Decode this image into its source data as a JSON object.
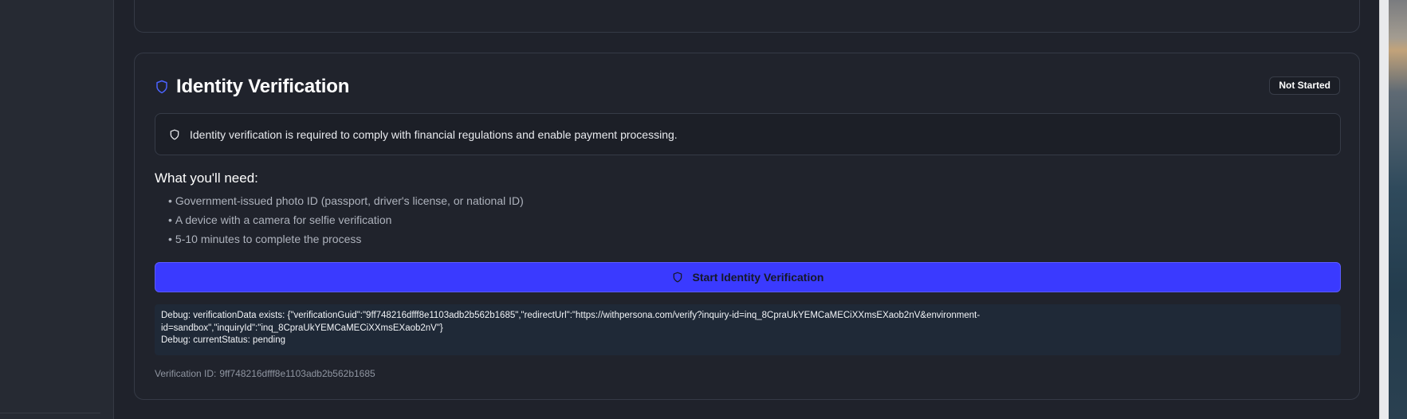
{
  "card": {
    "title": "Identity Verification",
    "status": "Not Started",
    "accent_color": "#3a3aff",
    "icon": "shield-icon"
  },
  "alert": {
    "icon": "shield-icon",
    "text": "Identity verification is required to comply with financial regulations and enable payment processing."
  },
  "requirements": {
    "heading": "What you'll need:",
    "items": [
      "Government-issued photo ID (passport, driver's license, or national ID)",
      "A device with a camera for selfie verification",
      "5-10 minutes to complete the process"
    ]
  },
  "start_button": {
    "label": "Start Identity Verification",
    "icon": "shield-icon"
  },
  "debug": {
    "line1": "Debug: verificationData exists: {\"verificationGuid\":\"9ff748216dfff8e1103adb2b562b1685\",\"redirectUrl\":\"https://withpersona.com/verify?inquiry-id=inq_8CpraUkYEMCaMECiXXmsEXaob2nV&environment-",
    "line2": "id=sandbox\",\"inquiryId\":\"inq_8CpraUkYEMCaMECiXXmsEXaob2nV\"}",
    "line3": "Debug: currentStatus: pending"
  },
  "verification_id": {
    "label": "Verification ID:",
    "value": "9ff748216dfff8e1103adb2b562b1685"
  }
}
